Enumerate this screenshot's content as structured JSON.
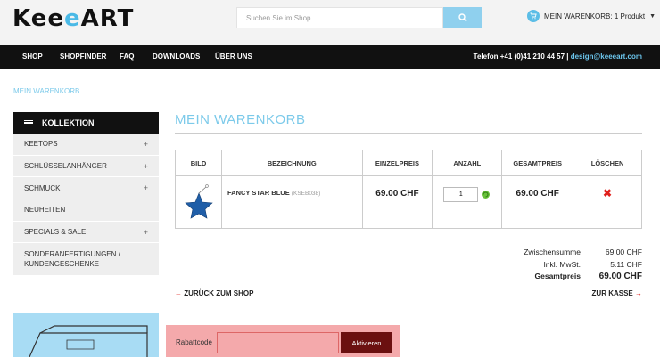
{
  "header": {
    "logo_text_start": "Kee",
    "logo_text_accent": "e",
    "logo_text_end": "ART",
    "search_placeholder": "Suchen Sie im Shop...",
    "cart_label": "MEIN WARENKORB: 1 Produkt",
    "accent_color": "#5bbde6"
  },
  "nav": {
    "items": [
      "SHOP",
      "SHOPFINDER",
      "FAQ",
      "DOWNLOADS",
      "ÜBER UNS"
    ],
    "phone": "Telefon +41 (0)41 210 44 57 |",
    "email": "design@keeeart.com"
  },
  "breadcrumb": "MEIN WARENKORB",
  "sidebar": {
    "heading": "KOLLEKTION",
    "items": [
      {
        "label": "KEETOPS",
        "expand": "+"
      },
      {
        "label": "SCHLÜSSELANHÄNGER",
        "expand": "+"
      },
      {
        "label": "SCHMUCK",
        "expand": "+"
      },
      {
        "label": "NEUHEITEN",
        "expand": ""
      },
      {
        "label": "SPECIALS & SALE",
        "expand": "+"
      },
      {
        "label_line1": "SONDERANFERTIGUNGEN /",
        "label_line2": "KUNDENGESCHENKE",
        "expand": ""
      }
    ]
  },
  "main": {
    "title": "MEIN WARENKORB",
    "columns": [
      "BILD",
      "BEZEICHNUNG",
      "EINZELPREIS",
      "ANZAHL",
      "GESAMTPREIS",
      "LÖSCHEN"
    ],
    "row": {
      "name": "FANCY STAR BLUE",
      "sku": "(KSEB038)",
      "unit_price": "69.00 CHF",
      "quantity": "1",
      "total_price": "69.00 CHF",
      "delete_glyph": "✖"
    },
    "totals": [
      {
        "label": "Zwischensumme",
        "value": "69.00 CHF"
      },
      {
        "label": "Inkl. MwSt.",
        "value": "5.11 CHF"
      },
      {
        "label": "Gesamtpreis",
        "value": "69.00 CHF"
      }
    ],
    "back_label": "ZURÜCK ZUM SHOP",
    "checkout_label": "ZUR KASSE",
    "coupon_label": "Rabattcode",
    "coupon_button": "Aktivieren"
  }
}
